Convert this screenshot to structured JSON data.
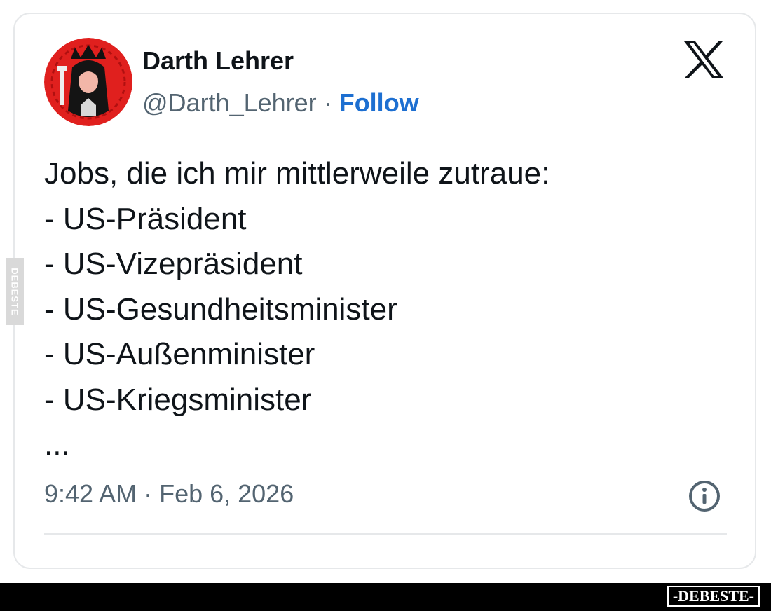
{
  "tweet": {
    "display_name": "Darth Lehrer",
    "handle": "@Darth_Lehrer",
    "separator": "·",
    "follow_label": "Follow",
    "lines": [
      "Jobs, die ich mir mittlerweile zutraue:",
      "- US-Präsident",
      "- US-Vizepräsident",
      "- US-Gesundheitsminister",
      "- US-Außenminister",
      "- US-Kriegsminister",
      "..."
    ],
    "timestamp": "9:42 AM · Feb 6, 2026"
  },
  "icons": {
    "platform_logo": "x-logo-icon",
    "info": "info-icon",
    "avatar": "avatar-image"
  },
  "watermark": {
    "side_text": "DEBESTE",
    "footer_text": "-DEBESTE-"
  },
  "colors": {
    "link": "#1d6fd1",
    "text": "#0f1419",
    "muted": "#536471",
    "border": "#e6e8ea",
    "avatar_red": "#e0201e"
  }
}
